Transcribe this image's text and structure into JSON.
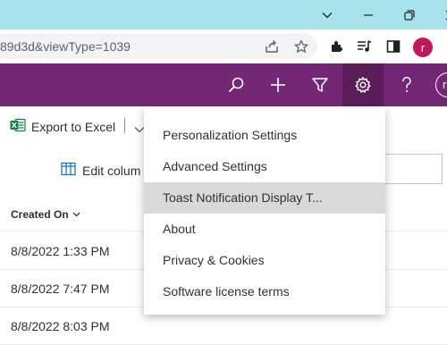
{
  "browser": {
    "url_fragment": "89d3d&viewType=1039",
    "profile_initial": "r"
  },
  "appbar": {
    "avatar_initial": "r"
  },
  "commandbar": {
    "export_label": "Export to Excel"
  },
  "grid": {
    "edit_columns_label": "Edit colum",
    "column_header": "Created On",
    "rows": [
      "8/8/2022 1:33 PM",
      "8/8/2022 7:47 PM",
      "8/8/2022 8:03 PM"
    ]
  },
  "settings_menu": {
    "items": [
      "Personalization Settings",
      "Advanced Settings",
      "Toast Notification Display T...",
      "About",
      "Privacy & Cookies",
      "Software license terms"
    ],
    "hovered_index": 2
  },
  "colors": {
    "titlebar": "#a8e2ea",
    "appbar": "#742774",
    "appbar_active": "#5a1d5a",
    "excel_green": "#107c41",
    "profile": "#c2185b"
  }
}
